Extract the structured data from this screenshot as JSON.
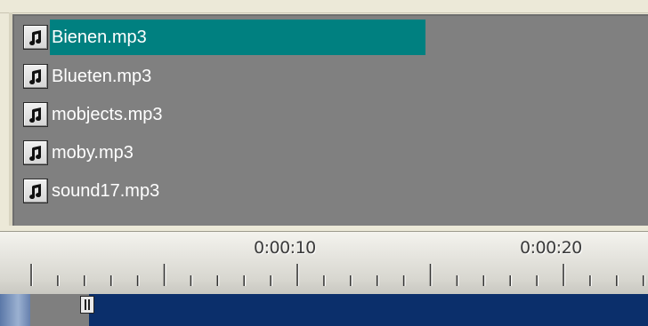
{
  "file_list": {
    "items": [
      {
        "name": "Bienen.mp3",
        "icon": "music-note-icon",
        "selected": true
      },
      {
        "name": "Blueten.mp3",
        "icon": "music-note-icon",
        "selected": false
      },
      {
        "name": "mobjects.mp3",
        "icon": "music-note-icon",
        "selected": false
      },
      {
        "name": "moby.mp3",
        "icon": "music-note-icon",
        "selected": false
      },
      {
        "name": "sound17.mp3",
        "icon": "music-note-icon",
        "selected": false
      }
    ],
    "selection_color": "#008080",
    "background_color": "#808080"
  },
  "timeline": {
    "labels": [
      "0:00:10",
      "0:00:20"
    ]
  }
}
